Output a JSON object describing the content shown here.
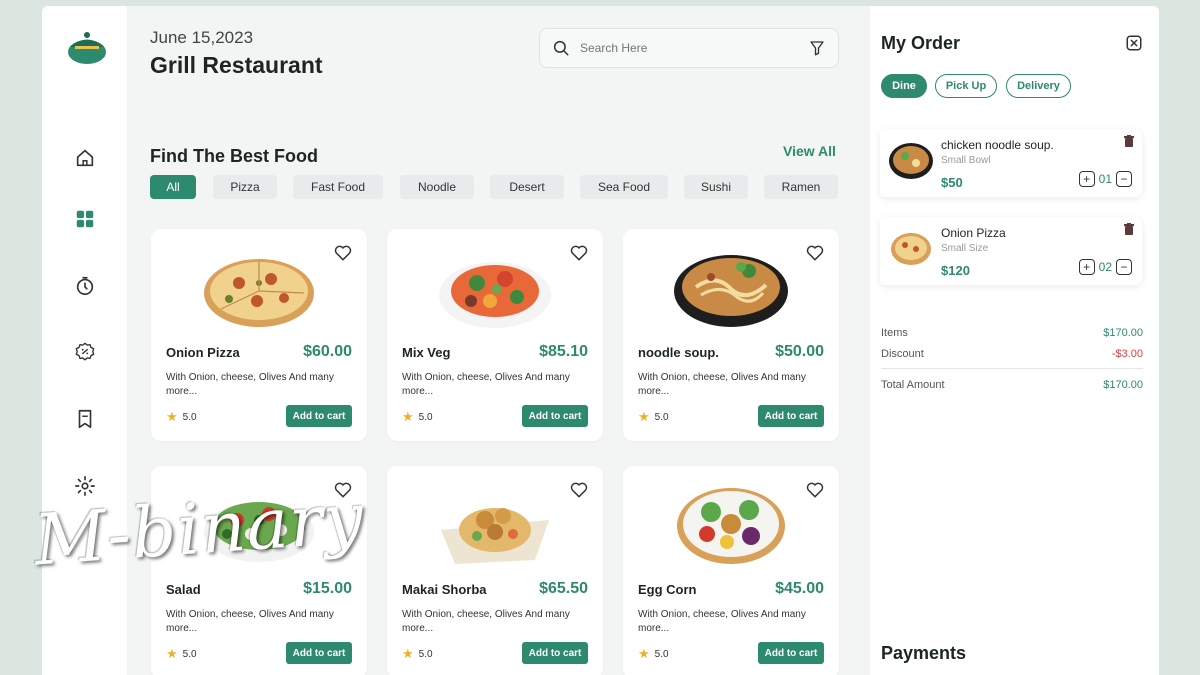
{
  "header": {
    "date": "June 15,2023",
    "restaurant_name": "Grill Restaurant"
  },
  "search": {
    "placeholder": "Search Here"
  },
  "sidebar": {
    "icons": [
      "logo-icon",
      "home-icon",
      "dashboard-icon",
      "timer-icon",
      "discount-icon",
      "bookmark-icon",
      "settings-icon"
    ]
  },
  "section": {
    "title": "Find The Best Food",
    "view_all": "View All"
  },
  "categories": [
    "All",
    "Pizza",
    "Fast Food",
    "Noodle",
    "Desert",
    "Sea Food",
    "Sushi",
    "Ramen"
  ],
  "active_category": "All",
  "foods": [
    {
      "name": "Onion Pizza",
      "price": "$60.00",
      "desc": "With Onion, cheese, Olives And many more...",
      "rating": "5.0",
      "cta": "Add to cart"
    },
    {
      "name": "Mix Veg",
      "price": "$85.10",
      "desc": "With Onion, cheese, Olives And many more...",
      "rating": "5.0",
      "cta": "Add to cart"
    },
    {
      "name": "noodle soup.",
      "price": "$50.00",
      "desc": "With Onion, cheese, Olives And many more...",
      "rating": "5.0",
      "cta": "Add to cart"
    },
    {
      "name": "Salad",
      "price": "$15.00",
      "desc": "With Onion, cheese, Olives And many more...",
      "rating": "5.0",
      "cta": "Add to cart"
    },
    {
      "name": "Makai Shorba",
      "price": "$65.50",
      "desc": "With Onion, cheese, Olives And many more...",
      "rating": "5.0",
      "cta": "Add to cart"
    },
    {
      "name": "Egg Corn",
      "price": "$45.00",
      "desc": "With Onion, cheese, Olives And many more...",
      "rating": "5.0",
      "cta": "Add to cart"
    }
  ],
  "order": {
    "title": "My Order",
    "modes": [
      "Dine",
      "Pick Up",
      "Delivery"
    ],
    "active_mode": "Dine",
    "items": [
      {
        "name": "chicken noodle soup.",
        "size": "Small Bowl",
        "price": "$50",
        "qty": "01"
      },
      {
        "name": "Onion Pizza",
        "size": "Small Size",
        "price": "$120",
        "qty": "02"
      }
    ],
    "summary": {
      "items_label": "Items",
      "items_value": "$170.00",
      "discount_label": "Discount",
      "discount_value": "-$3.00",
      "total_label": "Total Amount",
      "total_value": "$170.00"
    },
    "payments_title": "Payments"
  },
  "watermark": "M-binary",
  "colors": {
    "accent": "#2d8a6e",
    "background": "#dbe6e1",
    "negative": "#e0403c",
    "star": "#f2b01e"
  }
}
